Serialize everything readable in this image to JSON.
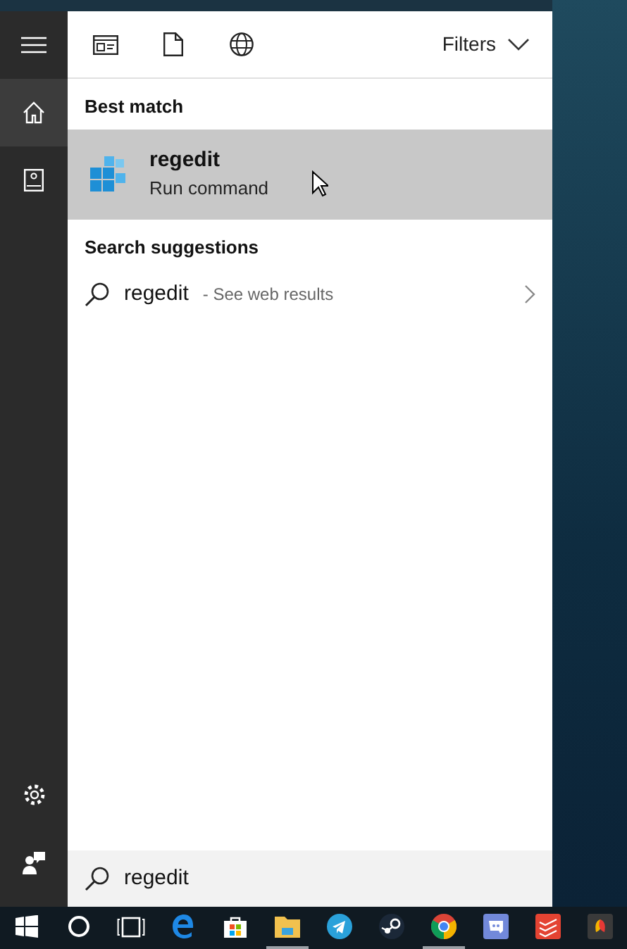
{
  "sidebar": {
    "top": [
      {
        "kind": "menu",
        "selected": false
      },
      {
        "kind": "home",
        "selected": true
      },
      {
        "kind": "notebook",
        "selected": false
      }
    ],
    "bottom": [
      {
        "kind": "settings",
        "selected": false
      },
      {
        "kind": "feedback",
        "selected": false
      }
    ]
  },
  "filter_bar": {
    "scopes": [
      {
        "kind": "apps"
      },
      {
        "kind": "documents"
      },
      {
        "kind": "web"
      }
    ],
    "filters_label": "Filters"
  },
  "best_match": {
    "heading": "Best match",
    "item": {
      "title": "regedit",
      "subtitle": "Run command",
      "selected": true
    }
  },
  "suggestions": {
    "heading": "Search suggestions",
    "items": [
      {
        "query": "regedit",
        "hint": "- See web results"
      }
    ]
  },
  "search_box": {
    "value": "regedit"
  },
  "taskbar": [
    {
      "kind": "start",
      "running": false
    },
    {
      "kind": "cortana",
      "running": false
    },
    {
      "kind": "taskview",
      "running": false
    },
    {
      "kind": "edge",
      "running": false
    },
    {
      "kind": "store",
      "running": false
    },
    {
      "kind": "explorer",
      "running": true
    },
    {
      "kind": "telegram",
      "running": false
    },
    {
      "kind": "steam",
      "running": false
    },
    {
      "kind": "chrome",
      "running": true
    },
    {
      "kind": "discord",
      "running": false
    },
    {
      "kind": "todoist",
      "running": false
    },
    {
      "kind": "app",
      "running": false
    }
  ]
}
